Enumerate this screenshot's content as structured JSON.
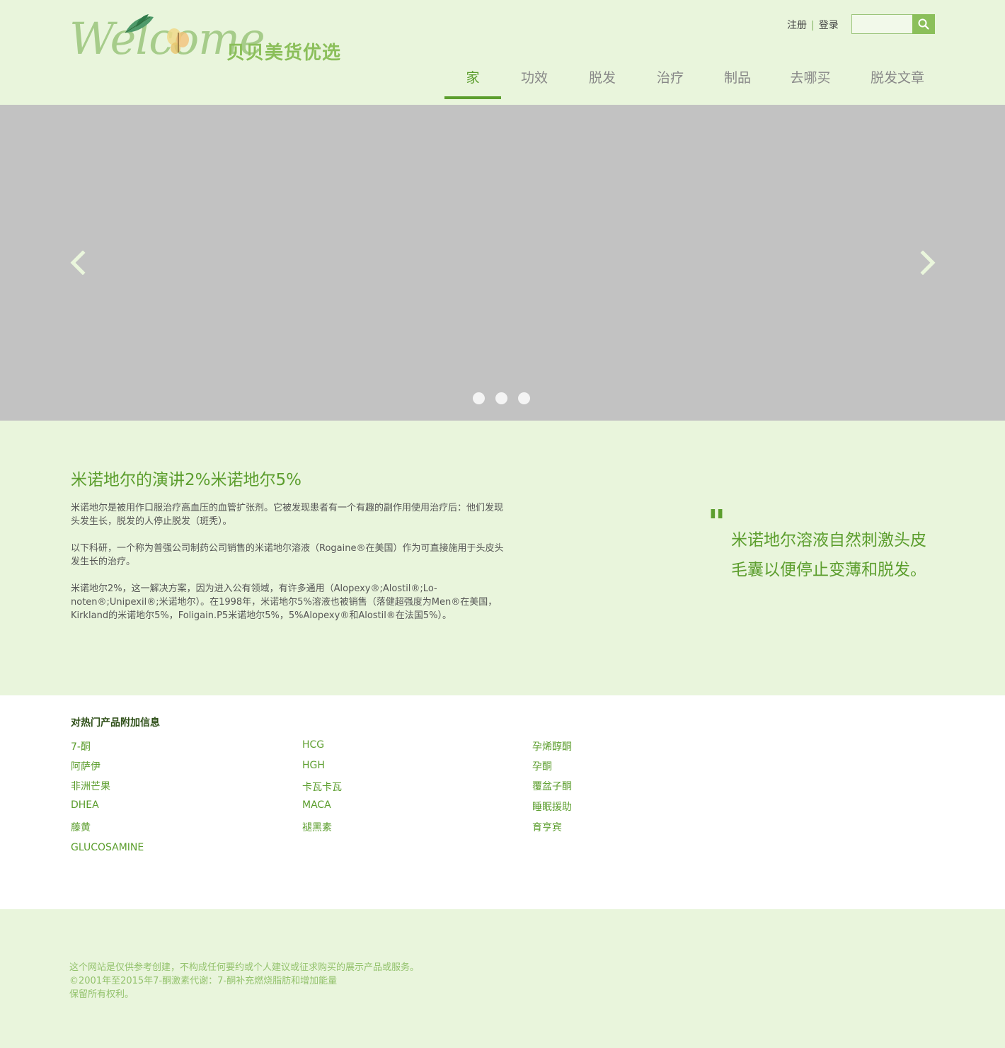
{
  "header": {
    "logo_script": "Welcome",
    "logo_text": "贝贝美货优选",
    "register_label": "注册",
    "login_label": "登录",
    "search_placeholder": "",
    "nav": [
      {
        "label": "家",
        "active": true
      },
      {
        "label": "功效"
      },
      {
        "label": "脱发"
      },
      {
        "label": "治疗"
      },
      {
        "label": "制品"
      },
      {
        "label": "去哪买"
      },
      {
        "label": "脱发文章"
      }
    ]
  },
  "slider": {
    "slide_count": 3,
    "active_slide": 1
  },
  "content": {
    "title": "米诺地尔的演讲2%米诺地尔5%",
    "paragraphs": [
      "米诺地尔是被用作口服治疗高血压的血管扩张剂。它被发现患者有一个有趣的副作用使用治疗后：他们发现头发生长，脱发的人停止脱发（斑秃）。",
      "以下科研，一个称为普强公司制药公司销售的米诺地尔溶液（Rogaine®在美国）作为可直接施用于头皮头发生长的治疗。",
      "米诺地尔2%，这一解决方案，因为进入公有领域，有许多通用（Alopexy®;Alostil®;Lo-noten®;Unipexil®;米诺地尔）。在1998年，米诺地尔5%溶液也被销售（落健超强度为Men®在美国，Kirkland的米诺地尔5%，Foligain.P5米诺地尔5%，5%Alopexy®和Alostil®在法国5%）。"
    ],
    "quote": "米诺地尔溶液自然刺激头皮毛囊以便停止变薄和脱发。"
  },
  "info": {
    "heading": "对热门产品附加信息",
    "columns": [
      [
        "7-酮",
        "阿萨伊",
        "非洲芒果",
        "DHEA",
        "藤黄",
        "GLUCOSAMINE"
      ],
      [
        "HCG",
        "HGH",
        "卡瓦卡瓦",
        "MACA",
        "褪黑素"
      ],
      [
        "孕烯醇酮",
        "孕酮",
        "覆盆子酮",
        "睡眠援助",
        "育亨宾"
      ]
    ]
  },
  "footer": {
    "lines": [
      "这个网站是仅供参考创建，不构成任何要约或个人建议或征求购买的展示产品或服务。",
      "©2001年至2015年7-酮激素代谢：7-酮补充燃烧脂肪和增加能量",
      "保留所有权利。"
    ]
  },
  "colors": {
    "background": "#e9f5dc",
    "accent": "#5c9e2e",
    "slider": "#c2c2c2",
    "footer_text": "#93c26c"
  }
}
